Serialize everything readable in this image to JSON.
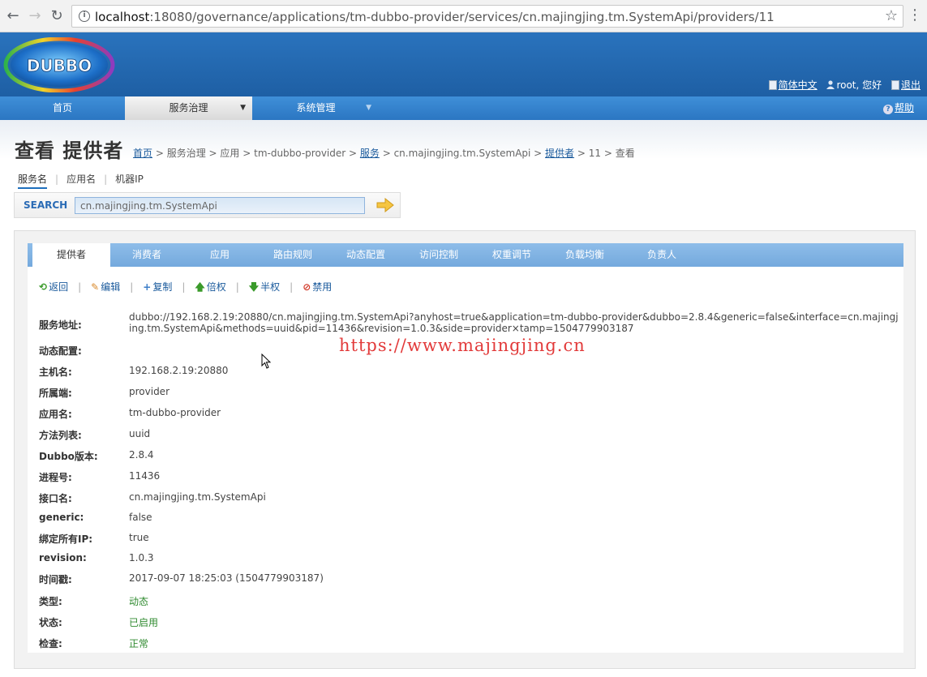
{
  "browser": {
    "url_host": "localhost",
    "url_path": ":18080/governance/applications/tm-dubbo-provider/services/cn.majingjing.tm.SystemApi/providers/11"
  },
  "header": {
    "logo_text": "DUBBO",
    "lang_link": "简体中文",
    "user_greeting": "root, 您好",
    "logout": "退出"
  },
  "menu": {
    "items": [
      {
        "label": "首页"
      },
      {
        "label": "服务治理"
      },
      {
        "label": "系统管理"
      }
    ],
    "help": "帮助"
  },
  "page": {
    "title": "查看 提供者",
    "breadcrumb": {
      "home": "首页",
      "sep": " > ",
      "governance": "服务治理",
      "apps": "应用",
      "app": "tm-dubbo-provider",
      "services": "服务",
      "service": "cn.majingjing.tm.SystemApi",
      "providers": "提供者",
      "id": "11",
      "view": "查看"
    }
  },
  "search": {
    "tabs": [
      "服务名",
      "应用名",
      "机器IP"
    ],
    "label": "SEARCH",
    "value": "cn.majingjing.tm.SystemApi"
  },
  "tabs": [
    "提供者",
    "消费者",
    "应用",
    "路由规则",
    "动态配置",
    "访问控制",
    "权重调节",
    "负载均衡",
    "负责人"
  ],
  "actions": {
    "back": "返回",
    "edit": "编辑",
    "copy": "复制",
    "double": "倍权",
    "half": "半权",
    "disable": "禁用"
  },
  "details": {
    "address_label": "服务地址:",
    "address": "dubbo://192.168.2.19:20880/cn.majingjing.tm.SystemApi?anyhost=true&application=tm-dubbo-provider&dubbo=2.8.4&generic=false&interface=cn.majingjing.tm.SystemApi&methods=uuid&pid=11436&revision=1.0.3&side=provider×tamp=1504779903187",
    "dynamic_label": "动态配置:",
    "host_label": "主机名:",
    "host": "192.168.2.19:20880",
    "side_label": "所属端:",
    "side": "provider",
    "app_label": "应用名:",
    "app": "tm-dubbo-provider",
    "methods_label": "方法列表:",
    "methods": "uuid",
    "dubbo_label": "Dubbo版本:",
    "dubbo": "2.8.4",
    "pid_label": "进程号:",
    "pid": "11436",
    "interface_label": "接口名:",
    "interface": "cn.majingjing.tm.SystemApi",
    "generic_label": "generic:",
    "generic": "false",
    "anyhost_label": "绑定所有IP:",
    "anyhost": "true",
    "revision_label": "revision:",
    "revision": "1.0.3",
    "timestamp_label": "时间戳:",
    "timestamp": "2017-09-07 18:25:03 (1504779903187)",
    "type_label": "类型:",
    "type": "动态",
    "status_label": "状态:",
    "status": "已启用",
    "check_label": "检查:",
    "check": "正常"
  },
  "watermark": "https://www.majingjing.cn",
  "colors": {
    "header_blue": "#2a73bd",
    "menu_blue": "#3f8fd8",
    "tab_blue": "#8ebde9",
    "link": "#1a5a9c",
    "status_green": "#2f8a2f",
    "watermark_red": "#e23a3a"
  },
  "icons": [
    "back-arrow-icon",
    "forward-arrow-icon",
    "reload-icon",
    "info-icon",
    "star-icon",
    "menu-dots-icon",
    "doc-icon",
    "user-icon",
    "logout-icon",
    "help-icon",
    "search-go-icon",
    "return-icon",
    "edit-icon",
    "copy-icon",
    "double-icon",
    "half-icon",
    "disable-icon",
    "cursor-icon"
  ]
}
